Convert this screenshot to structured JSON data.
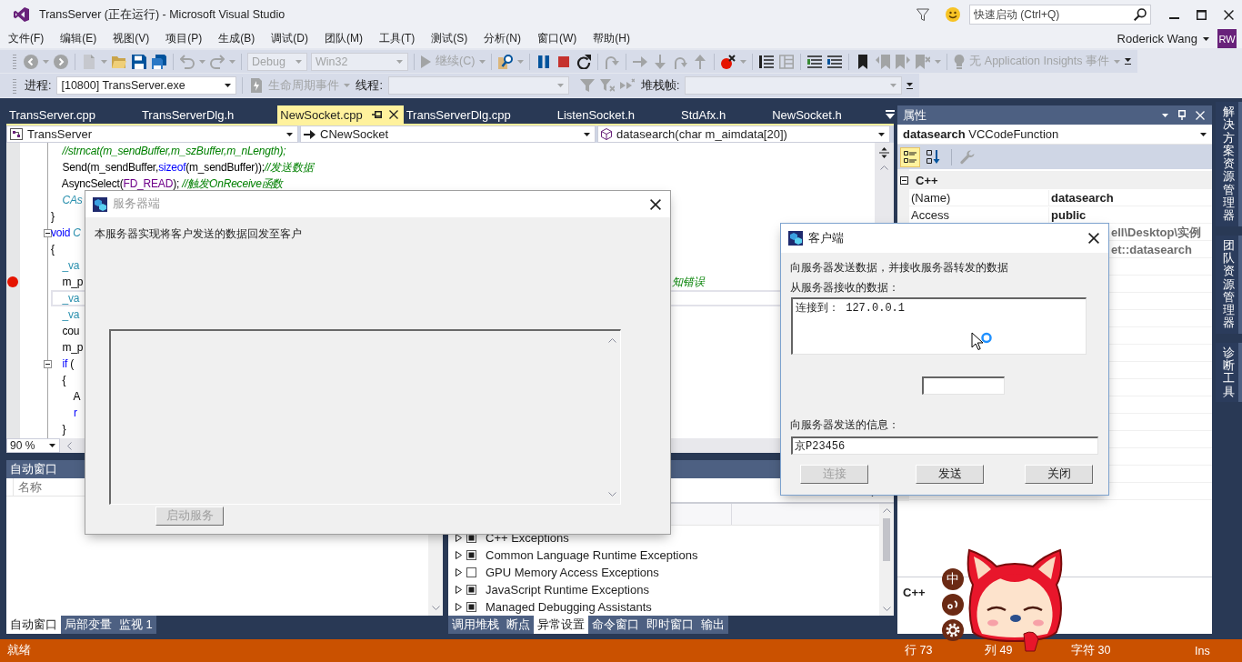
{
  "window": {
    "title": "TransServer (正在运行) - Microsoft Visual Studio",
    "quick_launch": {
      "placeholder": "快速启动 (Ctrl+Q)"
    }
  },
  "menu": {
    "items": [
      "文件(F)",
      "编辑(E)",
      "视图(V)",
      "项目(P)",
      "生成(B)",
      "调试(D)",
      "团队(M)",
      "工具(T)",
      "测试(S)",
      "分析(N)",
      "窗口(W)",
      "帮助(H)"
    ],
    "user": "Roderick Wang",
    "avatar": "RW"
  },
  "toolbar": {
    "configuration": {
      "value": "Debug",
      "disabled": true
    },
    "platform": {
      "value": "Win32",
      "disabled": true
    },
    "continue": {
      "label": "继续(C)",
      "disabled": true
    },
    "insights": {
      "label": "无 Application Insights 事件",
      "disabled": true
    }
  },
  "debug_location": {
    "process_label": "进程:",
    "process": "[10800] TransServer.exe",
    "lifecycle": {
      "label": "生命周期事件",
      "disabled": true
    },
    "thread_label": "线程:",
    "thread": {
      "disabled": true
    },
    "stack_label": "堆栈帧:",
    "stack_frame": {
      "disabled": true
    }
  },
  "editor": {
    "tabs": [
      {
        "label": "TransServer.cpp",
        "selected": false
      },
      {
        "label": "TransServerDlg.h",
        "selected": false
      },
      {
        "label": "NewSocket.cpp",
        "selected": true
      },
      {
        "label": "TransServerDlg.cpp",
        "selected": false
      },
      {
        "label": "ListenSocket.h",
        "selected": false
      },
      {
        "label": "StdAfx.h",
        "selected": false
      },
      {
        "label": "NewSocket.h",
        "selected": false
      }
    ],
    "nav": [
      "TransServer",
      "CNewSocket",
      "datasearch(char m_aimdata[20])"
    ],
    "lines": [
      {
        "parts": [
          {
            "kind": "comment",
            "text": "    //strncat(m_sendBuffer,m_szBuffer,m_nLength);"
          }
        ],
        "breakpoint": false,
        "current": false,
        "foldable": false
      },
      {
        "parts": [
          {
            "kind": "plain",
            "text": "    Send(m_sendBuffer,"
          },
          {
            "kind": "keyword",
            "text": "sizeof"
          },
          {
            "kind": "plain",
            "text": "(m_sendBuffer));"
          },
          {
            "kind": "comment",
            "text": "//发送数据"
          }
        ],
        "breakpoint": false,
        "current": false,
        "foldable": false
      },
      {
        "parts": [
          {
            "kind": "plain",
            "text": "    AsyncSelect("
          },
          {
            "kind": "macro",
            "text": "FD_READ"
          },
          {
            "kind": "plain",
            "text": "); "
          },
          {
            "kind": "comment",
            "text": "//触发OnReceive函数"
          }
        ],
        "breakpoint": false,
        "current": false,
        "foldable": false
      },
      {
        "parts": [
          {
            "kind": "type",
            "text": "    CAs"
          }
        ],
        "breakpoint": false,
        "current": false,
        "foldable": false
      },
      {
        "parts": [
          {
            "kind": "plain",
            "text": "}"
          }
        ],
        "breakpoint": false,
        "current": false,
        "foldable": false
      },
      {
        "parts": [
          {
            "kind": "keyword",
            "text": "void"
          },
          {
            "kind": "type",
            "text": " C"
          }
        ],
        "breakpoint": false,
        "current": false,
        "foldable": true
      },
      {
        "parts": [
          {
            "kind": "plain",
            "text": "{"
          }
        ],
        "breakpoint": false,
        "current": false,
        "foldable": false
      },
      {
        "parts": [
          {
            "kind": "class",
            "text": "    _va"
          }
        ],
        "breakpoint": false,
        "current": false,
        "foldable": false
      },
      {
        "parts": [
          {
            "kind": "plain",
            "text": "    m_p"
          }
        ],
        "tail": {
          "kind": "comment",
          "text": "知错误"
        },
        "breakpoint": true,
        "current": false,
        "foldable": false
      },
      {
        "parts": [
          {
            "kind": "class",
            "text": "    _va"
          }
        ],
        "breakpoint": false,
        "current": true,
        "foldable": false
      },
      {
        "parts": [
          {
            "kind": "class",
            "text": "    _va"
          }
        ],
        "breakpoint": false,
        "current": false,
        "foldable": false
      },
      {
        "parts": [
          {
            "kind": "plain",
            "text": "    cou"
          }
        ],
        "breakpoint": false,
        "current": false,
        "foldable": false
      },
      {
        "parts": [
          {
            "kind": "plain",
            "text": "    m_p"
          }
        ],
        "breakpoint": false,
        "current": false,
        "foldable": false
      },
      {
        "parts": [
          {
            "kind": "keyword",
            "text": "    if"
          },
          {
            "kind": "plain",
            "text": " ("
          }
        ],
        "breakpoint": false,
        "current": false,
        "foldable": true
      },
      {
        "parts": [
          {
            "kind": "plain",
            "text": "    {"
          }
        ],
        "breakpoint": false,
        "current": false,
        "foldable": false
      },
      {
        "parts": [
          {
            "kind": "plain",
            "text": "        A"
          }
        ],
        "breakpoint": false,
        "current": false,
        "foldable": false
      },
      {
        "parts": [
          {
            "kind": "keyword",
            "text": "        r"
          }
        ],
        "breakpoint": false,
        "current": false,
        "foldable": false
      },
      {
        "parts": [
          {
            "kind": "plain",
            "text": "    }"
          }
        ],
        "breakpoint": false,
        "current": false,
        "foldable": false
      }
    ],
    "zoom": "90 %"
  },
  "autos": {
    "title": "自动窗口",
    "column": "名称",
    "tabs": [
      {
        "label": "自动窗口",
        "selected": true
      },
      {
        "label": "局部变量",
        "selected": false
      },
      {
        "label": "监视 1",
        "selected": false
      }
    ]
  },
  "exceptions": {
    "rows": [
      {
        "label": "C++ Exceptions",
        "checked": true,
        "expanded": false
      },
      {
        "label": "Common Language Runtime Exceptions",
        "checked": true,
        "expanded": false
      },
      {
        "label": "GPU Memory Access Exceptions",
        "checked": false,
        "expanded": false
      },
      {
        "label": "JavaScript Runtime Exceptions",
        "checked": true,
        "expanded": false
      },
      {
        "label": "Managed Debugging Assistants",
        "checked": true,
        "expanded": false
      }
    ],
    "tabs": [
      {
        "label": "调用堆栈",
        "selected": false
      },
      {
        "label": "断点",
        "selected": false
      },
      {
        "label": "异常设置",
        "selected": true
      },
      {
        "label": "命令窗口",
        "selected": false
      },
      {
        "label": "即时窗口",
        "selected": false
      },
      {
        "label": "输出",
        "selected": false
      }
    ]
  },
  "properties": {
    "title": "属性",
    "object": "**datasearch** VCCodeFunction",
    "sort_buttons": [
      {
        "selected": true
      },
      {
        "selected": false
      }
    ],
    "category": {
      "label": "C++",
      "expanded": true
    },
    "rows": [
      {
        "name": "(Name)",
        "value": "datasearch",
        "readonly": false
      },
      {
        "name": "Access",
        "value": "public",
        "readonly": false
      },
      {
        "value": "ell\\Desktop\\实例",
        "readonly": true
      },
      {
        "value": "et::datasearch",
        "readonly": true
      }
    ],
    "description": "C++"
  },
  "side_tabs": [
    "解决方案资源管理器",
    "团队资源管理器",
    "诊断工具"
  ],
  "status_bar": {
    "message": "就绪",
    "line": "行 73",
    "column": "列 49",
    "character": "字符 30",
    "mode": "Ins"
  },
  "server_dialog": {
    "title": "服务器端",
    "active": false,
    "description": "本服务器实现将客户发送的数据回发至客户",
    "start_button": {
      "label": "启动服务",
      "disabled": true
    }
  },
  "client_dialog": {
    "title": "客户端",
    "active": true,
    "intro": "向服务器发送数据，并接收服务器转发的数据",
    "received_label": "从服务器接收的数据：",
    "received": "连接到： 127.0.0.1",
    "send_label": "向服务器发送的信息：",
    "message": "京P23456",
    "buttons": [
      {
        "label": "连接",
        "disabled": true
      },
      {
        "label": "发送",
        "disabled": false
      },
      {
        "label": "关闭",
        "disabled": false
      }
    ]
  },
  "ime": {
    "mode": "中"
  }
}
